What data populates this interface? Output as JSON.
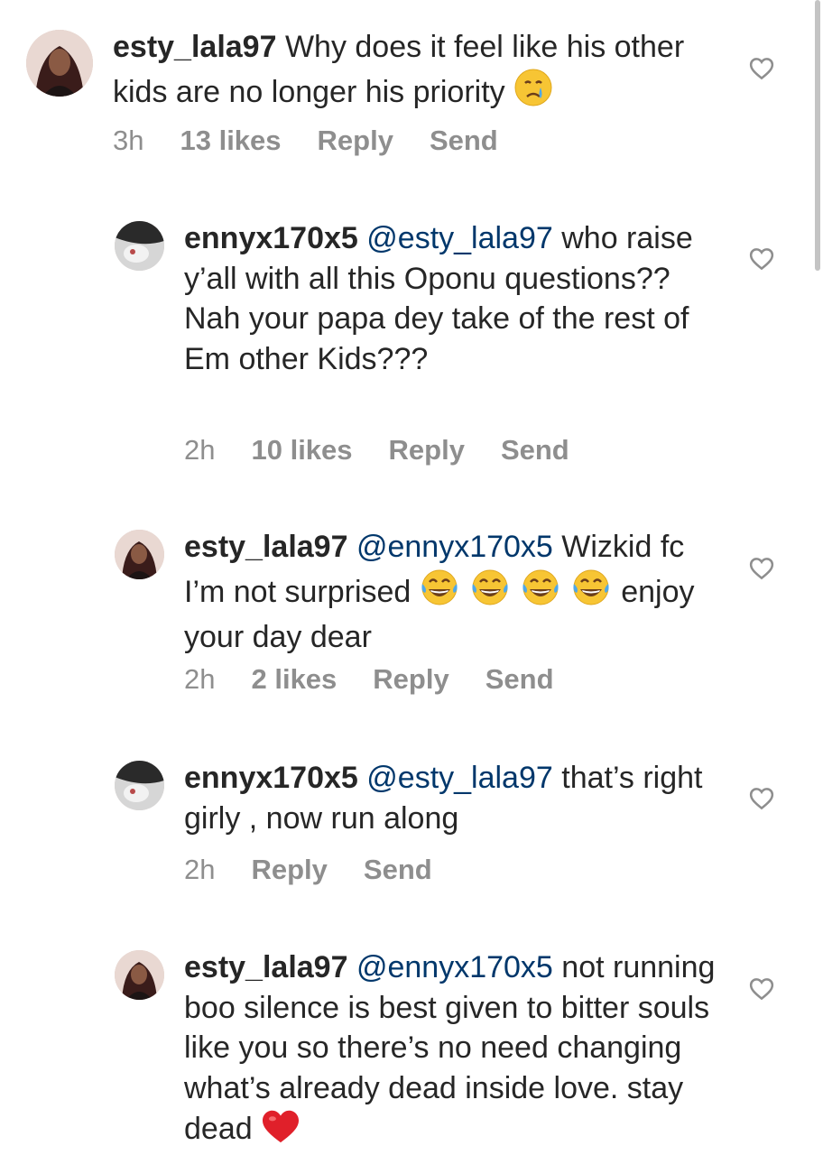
{
  "comments": [
    {
      "username": "esty_lala97",
      "mention": "",
      "text": " Why does it feel like his other kids are no longer his priority",
      "emoji": "crying-face",
      "time": "3h",
      "likes": "13 likes",
      "reply": "Reply",
      "send": "Send"
    },
    {
      "username": "ennyx170x5",
      "mention": "@esty_lala97",
      "text": " who raise y’all with all this Oponu questions?? Nah your papa dey take of the rest of Em other Kids???",
      "time": "2h",
      "likes": "10 likes",
      "reply": "Reply",
      "send": "Send"
    },
    {
      "username": "esty_lala97",
      "mention": "@ennyx170x5",
      "text_before": " Wizkid fc I’m not surprised ",
      "emoji": "tears-of-joy-x4",
      "text_after": " enjoy your day dear",
      "time": "2h",
      "likes": "2 likes",
      "reply": "Reply",
      "send": "Send"
    },
    {
      "username": "ennyx170x5",
      "mention": "@esty_lala97",
      "text": " that’s right girly , now run along",
      "time": "2h",
      "reply": "Reply",
      "send": "Send"
    },
    {
      "username": "esty_lala97",
      "mention": "@ennyx170x5",
      "text": " not running boo silence is best given to bitter souls like you so there’s no need changing what’s already dead inside love. stay dead",
      "emoji": "red-heart"
    }
  ],
  "colors": {
    "text": "#262626",
    "meta": "#8e8e8e",
    "mention": "#00376b",
    "heart_outline": "#8e8e8e",
    "red_heart": "#e0202a"
  }
}
